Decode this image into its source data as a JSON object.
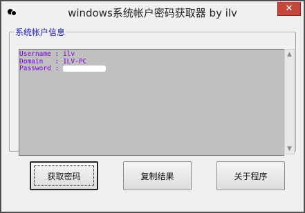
{
  "window": {
    "title": "windows系统帐户密码获取器 by ilv",
    "close_glyph": "✕"
  },
  "group": {
    "label": "系统帐户信息",
    "lines": [
      {
        "key": "Username",
        "sep": " : ",
        "value": "ilv"
      },
      {
        "key": "Domain  ",
        "sep": " : ",
        "value": "ILV-PC"
      },
      {
        "key": "Password",
        "sep": " : ",
        "value": ""
      }
    ]
  },
  "buttons": {
    "get_password": "获取密码",
    "copy_result": "复制结果",
    "about": "关于程序"
  },
  "colors": {
    "text_purple": "#7b00d6",
    "group_label_blue": "#1a1aa6",
    "close_red": "#c7463c"
  },
  "icons": {
    "app": "balls-icon",
    "close": "close-icon",
    "scroll_up": "chevron-up-icon",
    "scroll_down": "chevron-down-icon"
  }
}
